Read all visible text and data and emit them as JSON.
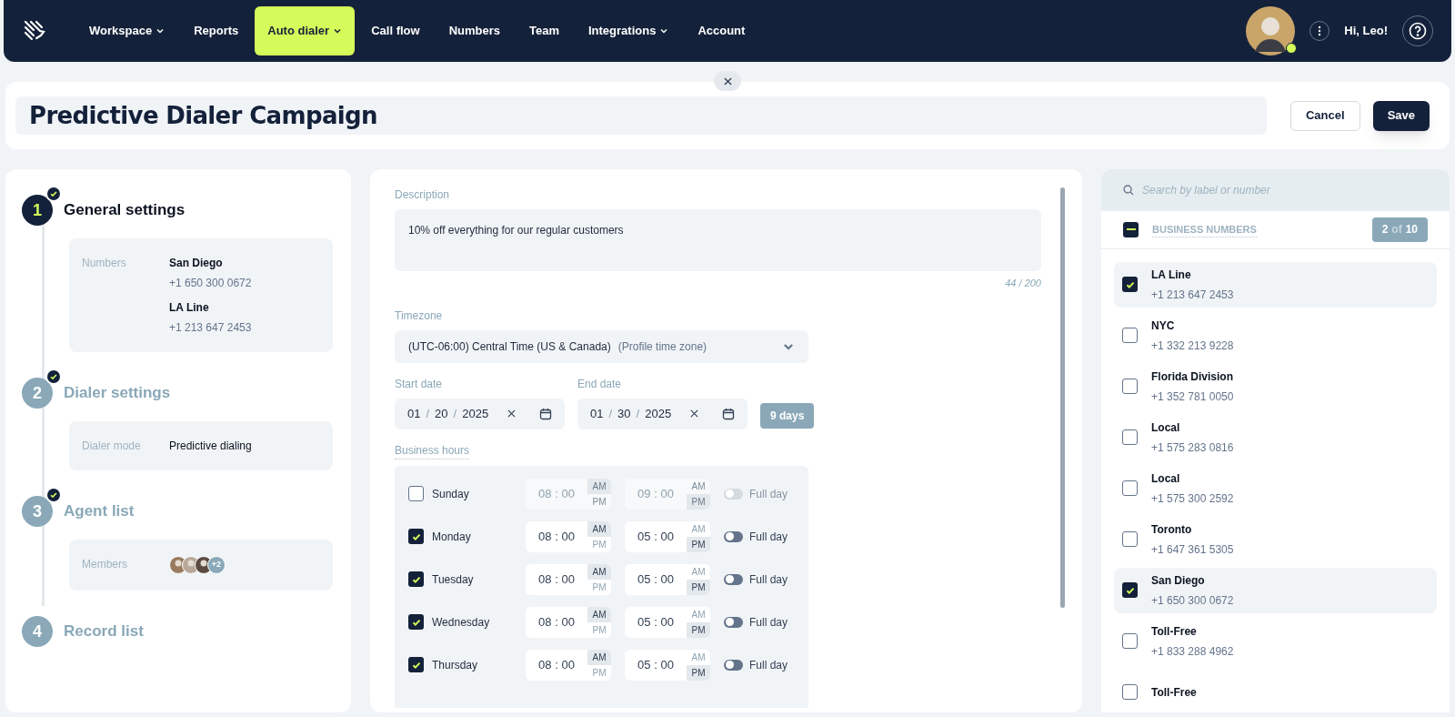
{
  "nav": {
    "items": [
      {
        "label": "Workspace",
        "dropdown": true,
        "selected": false
      },
      {
        "label": "Reports",
        "dropdown": false,
        "selected": false
      },
      {
        "label": "Auto dialer",
        "dropdown": true,
        "selected": true
      },
      {
        "label": "Call flow",
        "dropdown": false,
        "selected": false
      },
      {
        "label": "Numbers",
        "dropdown": false,
        "selected": false
      },
      {
        "label": "Team",
        "dropdown": false,
        "selected": false
      },
      {
        "label": "Integrations",
        "dropdown": true,
        "selected": false
      },
      {
        "label": "Account",
        "dropdown": false,
        "selected": false
      }
    ],
    "user": {
      "greeting": "Hi, Leo!",
      "online": true
    }
  },
  "header": {
    "title": "Predictive Dialer Campaign",
    "buttons": [
      {
        "label": "Cancel",
        "kind": "secondary"
      },
      {
        "label": "Save",
        "kind": "primary"
      }
    ]
  },
  "steps": [
    {
      "number": "1",
      "title": "General settings",
      "active": true,
      "completed": true,
      "details": [
        {
          "label": "Numbers",
          "kind": "numbers",
          "entries": [
            {
              "name": "San Diego",
              "phone": "+1 650 300 0672"
            },
            {
              "name": "LA Line",
              "phone": "+1 213 647 2453"
            }
          ]
        }
      ]
    },
    {
      "number": "2",
      "title": "Dialer settings",
      "active": false,
      "completed": true,
      "details": [
        {
          "label": "Dialer mode",
          "kind": "text",
          "value": "Predictive dialing"
        }
      ]
    },
    {
      "number": "3",
      "title": "Agent list",
      "active": false,
      "completed": true,
      "details": [
        {
          "label": "Members",
          "kind": "members",
          "extra": "+2"
        }
      ]
    },
    {
      "number": "4",
      "title": "Record list",
      "active": false,
      "completed": false
    }
  ],
  "form": {
    "description": {
      "label": "Description",
      "value": "10% off everything for our regular customers",
      "counter": "44 / 200"
    },
    "timezone": {
      "label": "Timezone",
      "value": "(UTC-06:00) Central Time (US & Canada)",
      "note": "(Profile time zone)"
    },
    "start_date": {
      "label": "Start date",
      "parts": [
        "01",
        "/",
        "20",
        "/",
        "2025"
      ]
    },
    "end_date": {
      "label": "End date",
      "parts": [
        "01",
        "/",
        "30",
        "/",
        "2025"
      ]
    },
    "duration": "9 days",
    "business_hours": {
      "label": "Business hours",
      "days": [
        {
          "day": "Sunday",
          "checked": false,
          "start": {
            "time": "08 : 00",
            "periods": [
              {
                "label": "AM",
                "selected": true
              },
              {
                "label": "PM",
                "selected": false
              }
            ]
          },
          "end": {
            "time": "09 : 00",
            "periods": [
              {
                "label": "AM",
                "selected": false
              },
              {
                "label": "PM",
                "selected": true
              }
            ]
          },
          "full_day": false,
          "full_day_label": "Full day"
        },
        {
          "day": "Monday",
          "checked": true,
          "start": {
            "time": "08 : 00",
            "periods": [
              {
                "label": "AM",
                "selected": true
              },
              {
                "label": "PM",
                "selected": false
              }
            ]
          },
          "end": {
            "time": "05 : 00",
            "periods": [
              {
                "label": "AM",
                "selected": false
              },
              {
                "label": "PM",
                "selected": true
              }
            ]
          },
          "full_day": false,
          "full_day_label": "Full day"
        },
        {
          "day": "Tuesday",
          "checked": true,
          "start": {
            "time": "08 : 00",
            "periods": [
              {
                "label": "AM",
                "selected": true
              },
              {
                "label": "PM",
                "selected": false
              }
            ]
          },
          "end": {
            "time": "05 : 00",
            "periods": [
              {
                "label": "AM",
                "selected": false
              },
              {
                "label": "PM",
                "selected": true
              }
            ]
          },
          "full_day": false,
          "full_day_label": "Full day"
        },
        {
          "day": "Wednesday",
          "checked": true,
          "start": {
            "time": "08 : 00",
            "periods": [
              {
                "label": "AM",
                "selected": true
              },
              {
                "label": "PM",
                "selected": false
              }
            ]
          },
          "end": {
            "time": "05 : 00",
            "periods": [
              {
                "label": "AM",
                "selected": false
              },
              {
                "label": "PM",
                "selected": true
              }
            ]
          },
          "full_day": false,
          "full_day_label": "Full day"
        },
        {
          "day": "Thursday",
          "checked": true,
          "start": {
            "time": "08 : 00",
            "periods": [
              {
                "label": "AM",
                "selected": true
              },
              {
                "label": "PM",
                "selected": false
              }
            ]
          },
          "end": {
            "time": "05 : 00",
            "periods": [
              {
                "label": "AM",
                "selected": false
              },
              {
                "label": "PM",
                "selected": true
              }
            ]
          },
          "full_day": false,
          "full_day_label": "Full day"
        }
      ]
    }
  },
  "numbers_panel": {
    "search": {
      "placeholder": "Search by label or number"
    },
    "select_all_partial": true,
    "header": "BUSINESS NUMBERS",
    "count_selected": "2",
    "count_of": "of",
    "count_total": "10",
    "items": [
      {
        "name": "LA Line",
        "phone": "+1 213 647 2453",
        "checked": true
      },
      {
        "name": "NYC",
        "phone": "+1 332 213 9228",
        "checked": false
      },
      {
        "name": "Florida Division",
        "phone": "+1 352 781 0050",
        "checked": false
      },
      {
        "name": "Local",
        "phone": "+1 575 283 0816",
        "checked": false
      },
      {
        "name": "Local",
        "phone": "+1 575 300 2592",
        "checked": false
      },
      {
        "name": "Toronto",
        "phone": "+1 647 361 5305",
        "checked": false
      },
      {
        "name": "San Diego",
        "phone": "+1 650 300 0672",
        "checked": true
      },
      {
        "name": "Toll-Free",
        "phone": "+1 833 288 4962",
        "checked": false
      },
      {
        "name": "Toll-Free",
        "checked": false
      }
    ]
  }
}
